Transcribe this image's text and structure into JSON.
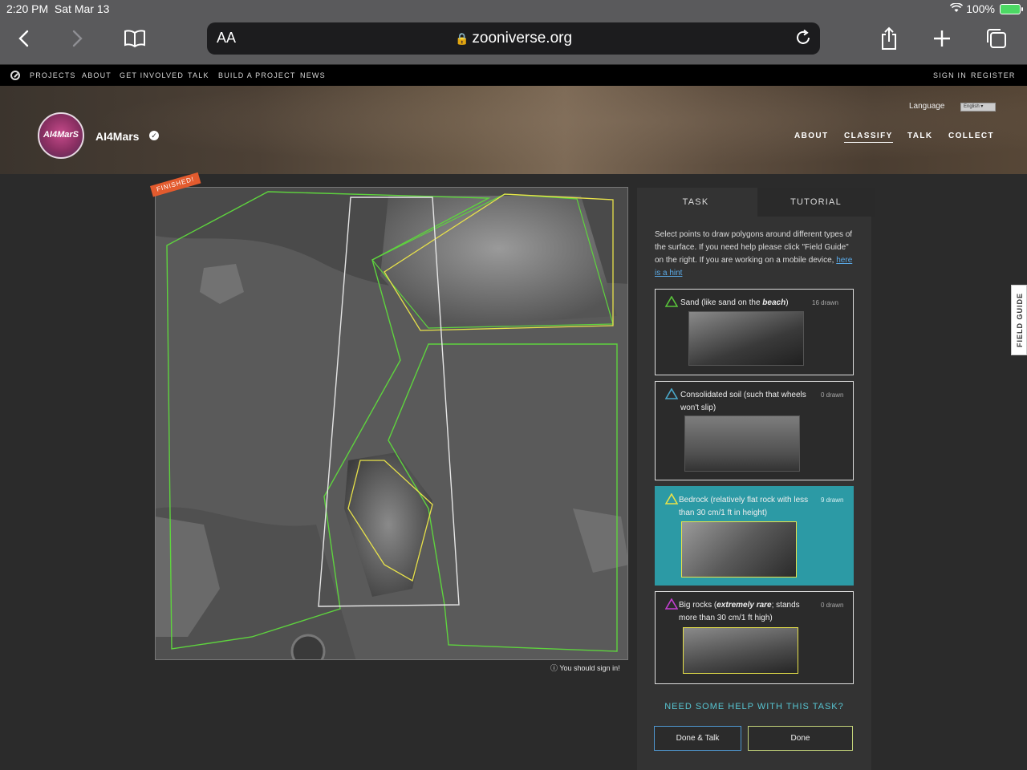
{
  "status_bar": {
    "time": "2:20 PM",
    "date": "Sat Mar 13",
    "battery": "100%"
  },
  "browser": {
    "aa_label": "AA",
    "url": "zooniverse.org"
  },
  "zoo_nav": {
    "items": [
      "PROJECTS",
      "ABOUT",
      "GET INVOLVED",
      "TALK",
      "BUILD A PROJECT",
      "NEWS"
    ],
    "sign_in": "SIGN IN",
    "register": "REGISTER"
  },
  "project": {
    "avatar_text": "AI4MarS",
    "title": "AI4Mars",
    "language_label": "Language",
    "language_value": "English",
    "nav": [
      "ABOUT",
      "CLASSIFY",
      "TALK",
      "COLLECT"
    ]
  },
  "subject": {
    "finished_badge": "FINISHED!",
    "signin_note": "You should sign in!"
  },
  "task_panel": {
    "tabs": [
      "TASK",
      "TUTORIAL"
    ],
    "instructions": "Select points to draw polygons around different types of the surface. If you need help please click \"Field Guide\" on the right. If you are working on a mobile device,",
    "hint_link": "here is a hint",
    "choices": [
      {
        "label_pre": "Sand (like sand on the ",
        "label_em": "beach",
        "label_post": ")",
        "count": "16 drawn",
        "color": "#59c43a"
      },
      {
        "label_pre": "Consolidated soil (such that wheels won't slip)",
        "label_em": "",
        "label_post": "",
        "count": "0 drawn",
        "color": "#4aa8c9"
      },
      {
        "label_pre": "Bedrock (relatively flat rock with less than 30 cm/1 ft in height)",
        "label_em": "",
        "label_post": "",
        "count": "9 drawn",
        "color": "#e8e24a"
      },
      {
        "label_pre": "Big rocks (",
        "label_em": "extremely rare",
        "label_post": "; stands more than 30 cm/1 ft high)",
        "count": "0 drawn",
        "color": "#c43fd1"
      }
    ],
    "help_link": "NEED SOME HELP WITH THIS TASK?",
    "done_talk": "Done & Talk",
    "done": "Done"
  },
  "field_guide": "FIELD GUIDE"
}
